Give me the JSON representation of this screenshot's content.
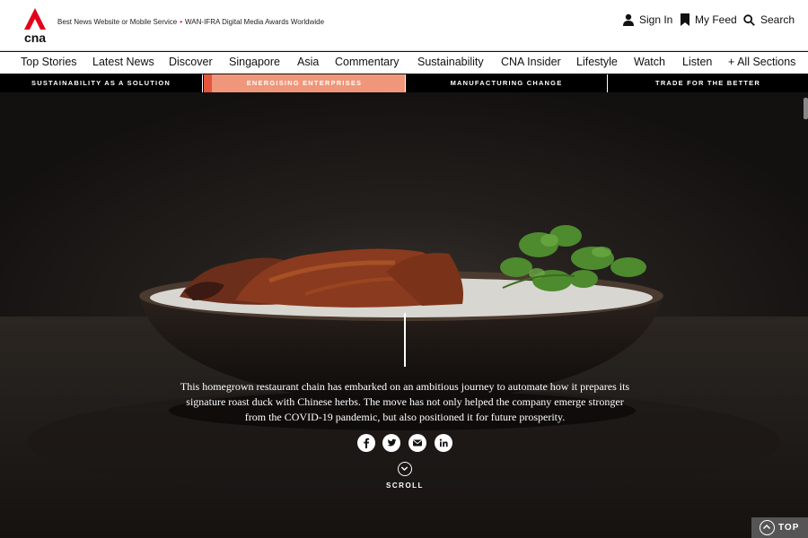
{
  "brand": {
    "logo_text": "cna"
  },
  "header": {
    "award_part1": "Best News Website or Mobile Service",
    "award_separator": "•",
    "award_part2": "WAN-IFRA Digital Media Awards Worldwide",
    "sign_in": "Sign In",
    "my_feed": "My Feed",
    "search": "Search"
  },
  "nav": {
    "items": [
      "Top Stories",
      "Latest News",
      "Discover",
      "Singapore",
      "Asia",
      "Commentary",
      "Sustainability",
      "CNA Insider",
      "Lifestyle",
      "Watch",
      "Listen",
      "+ All Sections"
    ]
  },
  "subnav": {
    "tabs": [
      "SUSTAINABILITY AS A SOLUTION",
      "ENERGISING ENTERPRISES",
      "MANUFACTURING CHANGE",
      "TRADE FOR THE BETTER"
    ],
    "active_index": 1
  },
  "hero": {
    "description": "This homegrown restaurant chain has embarked on an ambitious journey to automate how it prepares its signature roast duck with Chinese herbs. The move has not only helped the company emerge stronger from the COVID-19 pandemic, but also positioned it for future prosperity.",
    "scroll_label": "SCROLL"
  },
  "share": [
    "facebook-icon",
    "twitter-icon",
    "email-icon",
    "linkedin-icon"
  ],
  "back_to_top": "TOP",
  "colors": {
    "brand_red": "#e2001a",
    "active_tab": "#f0967a",
    "tab_accent": "#e6543c"
  }
}
